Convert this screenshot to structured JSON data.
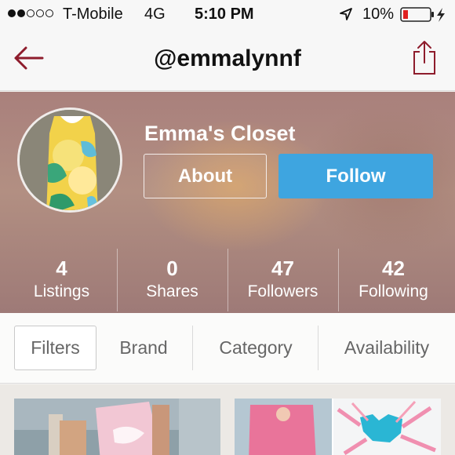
{
  "status_bar": {
    "carrier": "T-Mobile",
    "network": "4G",
    "time": "5:10 PM",
    "battery": "10%",
    "signal_bars_filled": 2,
    "signal_bars_total": 5
  },
  "nav": {
    "title": "@emmalynnf",
    "back_icon": "arrow-left-icon",
    "share_icon": "share-icon"
  },
  "profile": {
    "closet_name": "Emma's Closet",
    "about_label": "About",
    "follow_label": "Follow"
  },
  "stats": [
    {
      "count": "4",
      "label": "Listings"
    },
    {
      "count": "0",
      "label": "Shares"
    },
    {
      "count": "47",
      "label": "Followers"
    },
    {
      "count": "42",
      "label": "Following"
    }
  ],
  "filters": [
    {
      "label": "Filters"
    },
    {
      "label": "Brand"
    },
    {
      "label": "Category"
    },
    {
      "label": "Availability"
    }
  ],
  "colors": {
    "accent_red": "#8e1c2c",
    "follow_blue": "#3ea5e0"
  }
}
